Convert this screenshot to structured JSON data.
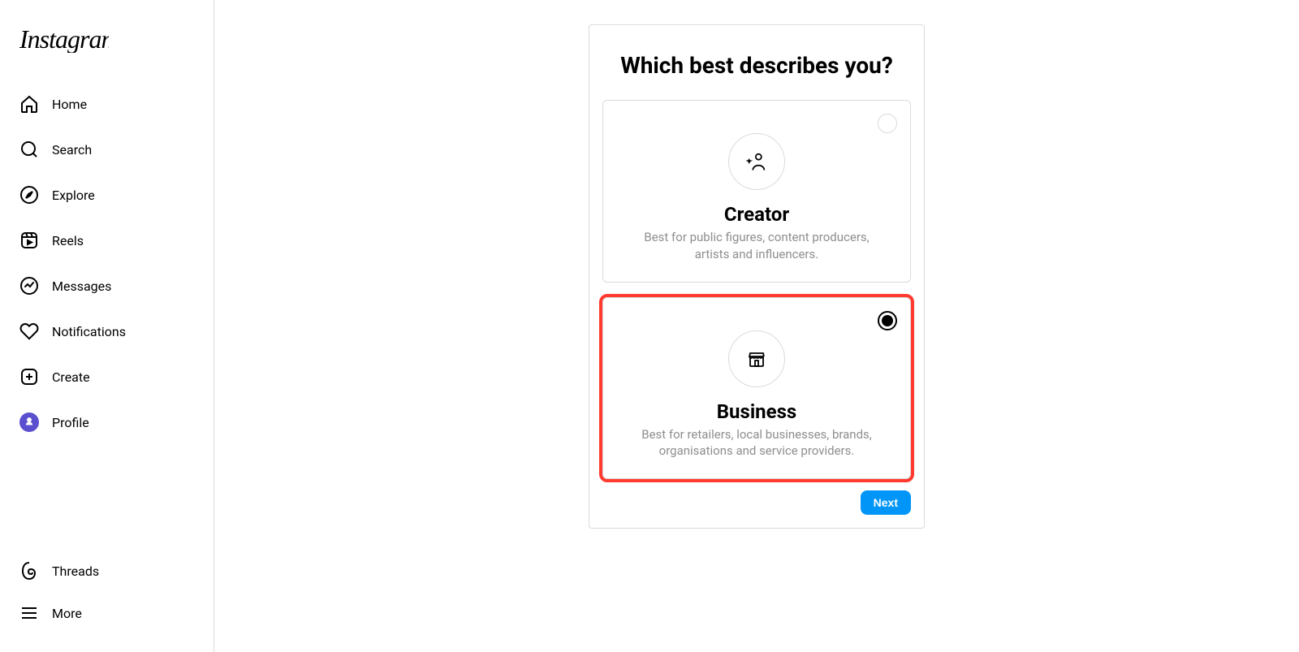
{
  "logo_text": "Instagram",
  "sidebar": {
    "items": [
      {
        "label": "Home",
        "icon": "home-icon"
      },
      {
        "label": "Search",
        "icon": "search-icon"
      },
      {
        "label": "Explore",
        "icon": "explore-icon"
      },
      {
        "label": "Reels",
        "icon": "reels-icon"
      },
      {
        "label": "Messages",
        "icon": "messages-icon"
      },
      {
        "label": "Notifications",
        "icon": "notifications-icon"
      },
      {
        "label": "Create",
        "icon": "create-icon"
      },
      {
        "label": "Profile",
        "icon": "profile-icon"
      }
    ],
    "bottom_items": [
      {
        "label": "Threads",
        "icon": "threads-icon"
      },
      {
        "label": "More",
        "icon": "more-icon"
      }
    ]
  },
  "card": {
    "title": "Which best describes you?",
    "options": [
      {
        "title": "Creator",
        "desc": "Best for public figures, content producers, artists and influencers.",
        "selected": false,
        "icon": "creator-icon"
      },
      {
        "title": "Business",
        "desc": "Best for retailers, local businesses, brands, organisations and service providers.",
        "selected": true,
        "icon": "business-icon",
        "highlighted": true
      }
    ],
    "next_button_label": "Next"
  }
}
